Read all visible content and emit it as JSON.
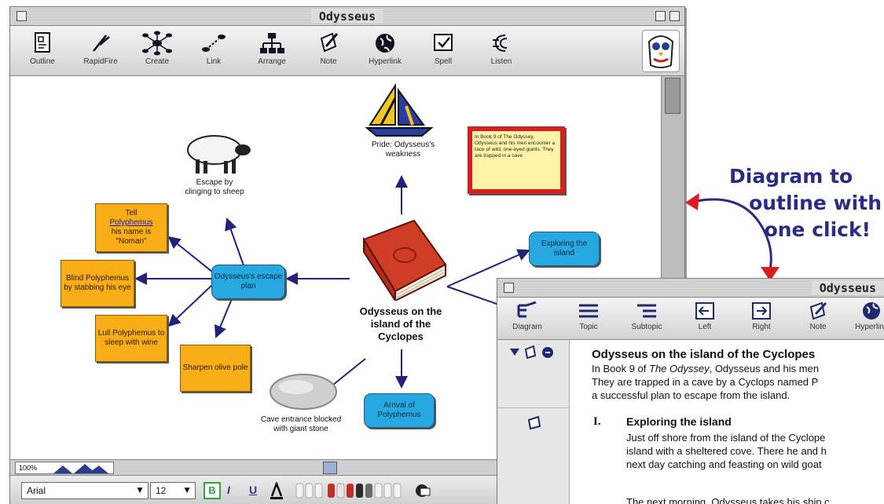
{
  "main_window": {
    "title": "Odysseus",
    "toolbar": [
      {
        "label": "Outline",
        "icon": "outline-icon"
      },
      {
        "label": "RapidFire",
        "icon": "rapidfire-icon"
      },
      {
        "label": "Create",
        "icon": "create-icon"
      },
      {
        "label": "Link",
        "icon": "link-icon"
      },
      {
        "label": "Arrange",
        "icon": "arrange-icon"
      },
      {
        "label": "Note",
        "icon": "note-icon"
      },
      {
        "label": "Hyperlink",
        "icon": "hyperlink-icon"
      },
      {
        "label": "Spell",
        "icon": "spell-icon"
      },
      {
        "label": "Listen",
        "icon": "listen-icon"
      }
    ]
  },
  "diagram": {
    "main_idea": "Odysseus on the island of the Cyclopes",
    "sail_caption": "Pride: Odysseus's weakness",
    "sheep_caption": "Escape by clinging to sheep",
    "stone_caption": "Cave entrance blocked with giant stone",
    "escape_plan": "Odysseus's escape plan",
    "exploring": "Exploring the island",
    "arrival": "Arrival of Polyphemus",
    "tell_pre": "Tell",
    "tell_link": "Polyphemus",
    "tell_post": "his name is \"Noman\"",
    "blind": "Blind Polyphemus by stabbing his eye",
    "lull": "Lull Polyphemus to sleep with wine",
    "sharpen": "Sharpen olive pole",
    "note_text": "In Book 9 of The Odyssey, Odysseus and his men encounter a race of wild, one-eyed giants. They are trapped in a cave"
  },
  "bottom": {
    "zoom": "100%",
    "font": "Arial",
    "size": "12",
    "bold": "B",
    "italic": "I",
    "underline": "U"
  },
  "callout": {
    "line1": "Diagram to",
    "line2": "outline with",
    "line3": "one click!"
  },
  "outline_window": {
    "title": "Odysseus",
    "toolbar": [
      {
        "label": "Diagram",
        "icon": "diagram-icon"
      },
      {
        "label": "Topic",
        "icon": "topic-icon"
      },
      {
        "label": "Subtopic",
        "icon": "subtopic-icon"
      },
      {
        "label": "Left",
        "icon": "left-icon"
      },
      {
        "label": "Right",
        "icon": "right-icon"
      },
      {
        "label": "Note",
        "icon": "note-icon"
      },
      {
        "label": "Hyperlink",
        "icon": "hyperlink-icon"
      }
    ],
    "heading": "Odysseus on the island of the Cyclopes",
    "para1_a": "In Book 9 of ",
    "para1_em": "The Odyssey",
    "para1_b": ", Odysseus and his men",
    "para1_line2": "They are trapped in a cave by a Cyclops named P",
    "para1_line3": "a successful plan to escape from the island.",
    "item_num": "I.",
    "item_title": "Exploring the island",
    "item_line1": "Just off shore from the island of the Cyclope",
    "item_line2": "island with a sheltered cove. There he and h",
    "item_line3": "next day catching and feasting on wild goat",
    "item_line4": "The next morning, Odysseus takes his ship c"
  }
}
